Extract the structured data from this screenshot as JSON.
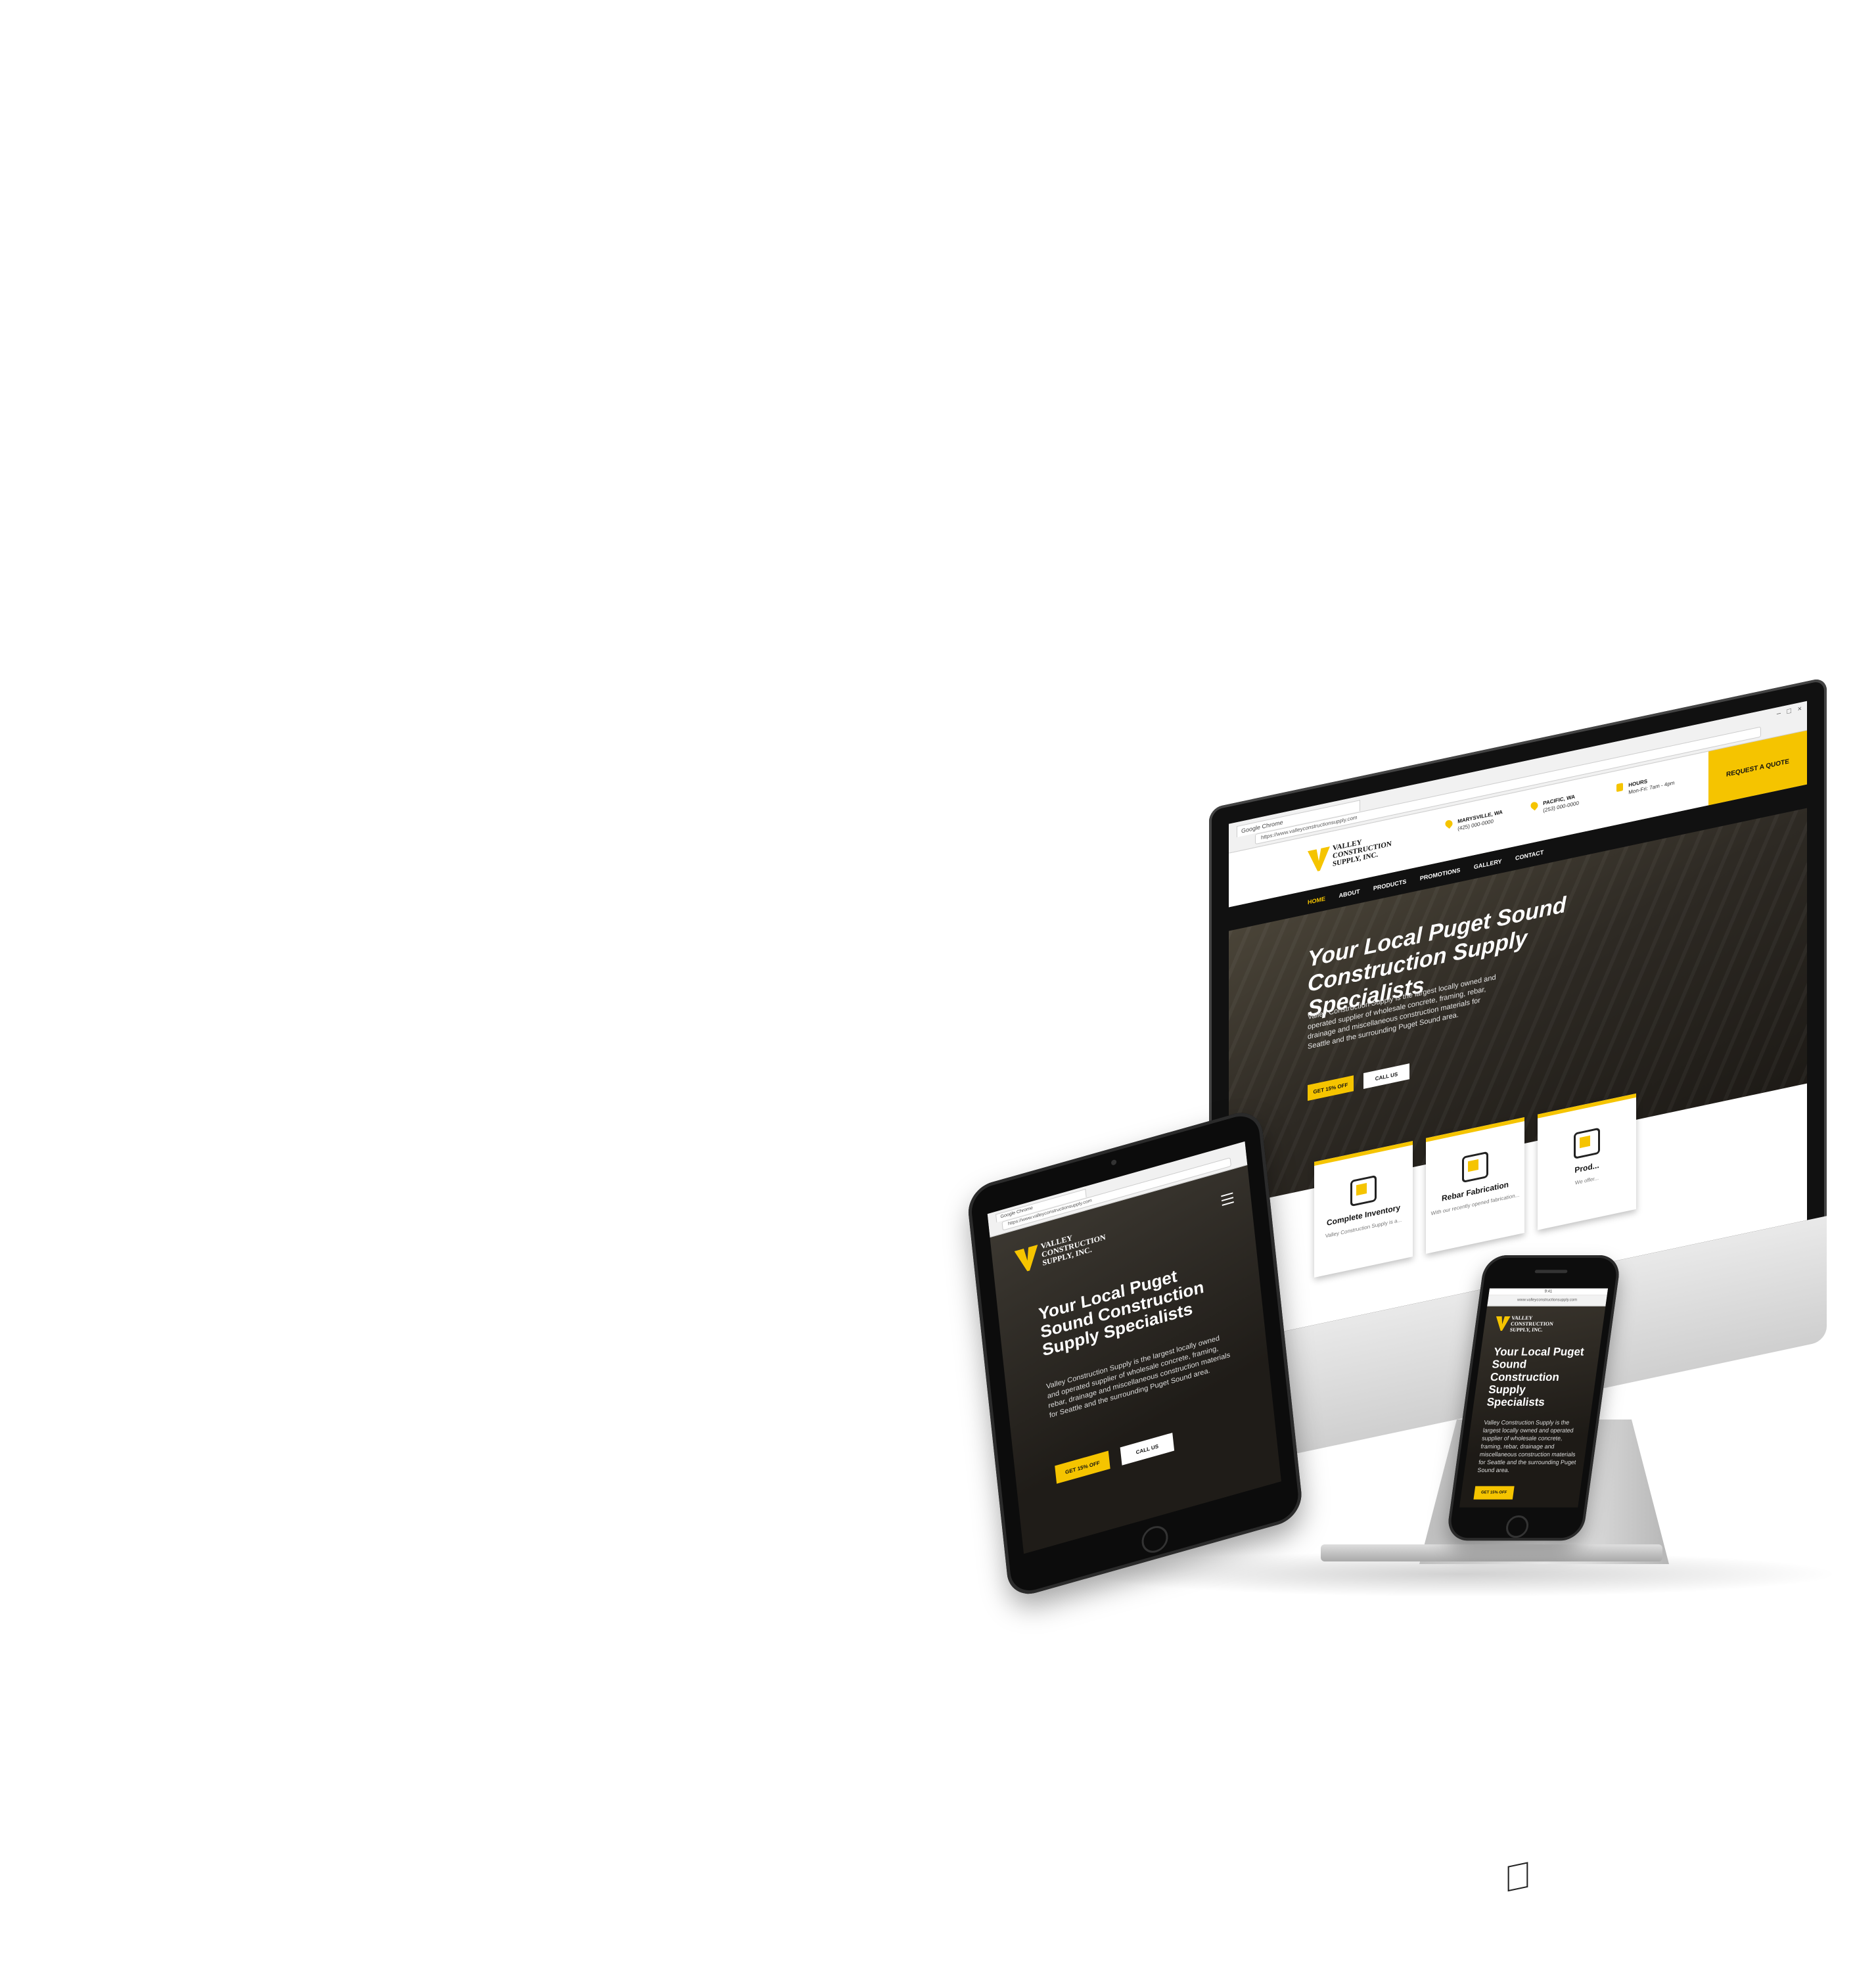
{
  "brand": {
    "logo_text": "VALLEY CONSTRUCTION SUPPLY, INC.",
    "accent_color": "#f5c400",
    "dark_color": "#111111"
  },
  "desktop": {
    "browser": {
      "tab_label": "Google Chrome",
      "url": "https://www.valleyconstructionsupply.com"
    },
    "contacts": [
      {
        "title": "MARYSVILLE, WA",
        "phone": "(425) 000-0000"
      },
      {
        "title": "PACIFIC, WA",
        "phone": "(253) 000-0000"
      },
      {
        "title": "HOURS",
        "phone": "Mon-Fri: 7am - 4pm"
      }
    ],
    "quote_button": "REQUEST A QUOTE",
    "nav": [
      "HOME",
      "ABOUT",
      "PRODUCTS",
      "PROMOTIONS",
      "GALLERY",
      "CONTACT"
    ],
    "hero": {
      "title": "Your Local Puget Sound Construction Supply Specialists",
      "text": "Valley Construction Supply is the largest locally owned and operated supplier of wholesale concrete, framing, rebar, drainage and miscellaneous construction materials for Seattle and the surrounding Puget Sound area.",
      "btn_primary": "GET 15% OFF",
      "btn_secondary": "CALL US"
    },
    "features": [
      {
        "title": "Complete Inventory",
        "sub": "Valley Construction Supply is a..."
      },
      {
        "title": "Rebar Fabrication",
        "sub": "With our recently opened fabrication..."
      },
      {
        "title": "Prod...",
        "sub": "We offer..."
      }
    ]
  },
  "tablet": {
    "browser": {
      "tab_label": "Google Chrome",
      "url": "https://www.valleyconstructionsupply.com"
    },
    "hero": {
      "title": "Your Local Puget Sound Construction Supply Specialists",
      "text": "Valley Construction Supply is the largest locally owned and operated supplier of wholesale concrete, framing, rebar, drainage and miscellaneous construction materials for Seattle and the surrounding Puget Sound area.",
      "btn_primary": "GET 15% OFF",
      "btn_secondary": "CALL US"
    }
  },
  "phone": {
    "status_time": "9:41",
    "url": "www.valleyconstructionsupply.com",
    "hero": {
      "title": "Your Local Puget Sound Construction Supply Specialists",
      "text": "Valley Construction Supply is the largest locally owned and operated supplier of wholesale concrete, framing, rebar, drainage and miscellaneous construction materials for Seattle and the surrounding Puget Sound area.",
      "btn_primary": "GET 15% OFF"
    }
  }
}
